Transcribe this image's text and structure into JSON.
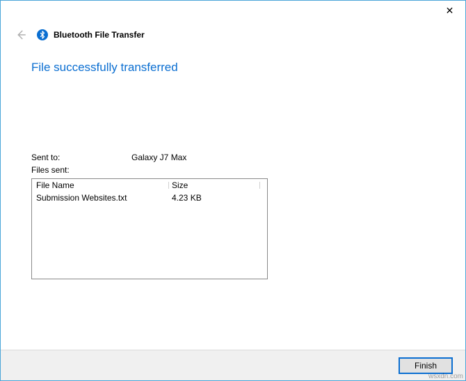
{
  "window": {
    "title": "Bluetooth File Transfer",
    "close_symbol": "✕"
  },
  "status": {
    "heading": "File successfully transferred"
  },
  "info": {
    "sent_to_label": "Sent to:",
    "sent_to_value": "Galaxy J7 Max",
    "files_sent_label": "Files sent:"
  },
  "table": {
    "col_name": "File Name",
    "col_size": "Size",
    "rows": [
      {
        "name": "Submission Websites.txt",
        "size": "4.23 KB"
      }
    ]
  },
  "footer": {
    "finish_label": "Finish"
  },
  "watermark": "wsxdn.com"
}
